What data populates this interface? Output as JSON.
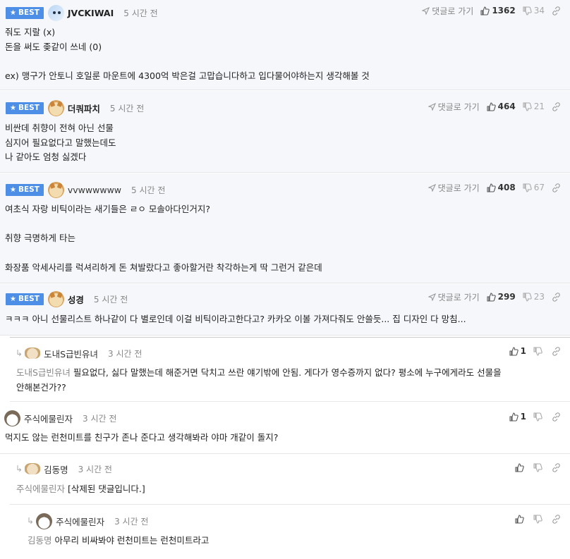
{
  "common": {
    "best_label": "BEST",
    "reply_link": "댓글로 가기"
  },
  "comments": [
    {
      "author": "JVCKIWAI",
      "time": "5 시간 전",
      "likes": "1362",
      "dislikes": "34",
      "lines": [
        "줘도 지랄 (x)",
        "돈을 써도 좆같이 쓰네 (0)",
        "",
        "ex) 맹구가 안토니 호일룬 마운트에 4300억 박은걸 고맙습니다하고 입다물어야하는지 생각해볼 것"
      ]
    },
    {
      "author": "더쿼파치",
      "time": "5 시간 전",
      "likes": "464",
      "dislikes": "21",
      "lines": [
        "비싼데 취향이 전혀 아닌 선물",
        "심지어 필요없다고 말했는데도",
        "나 같아도 엄청 싫겠다"
      ]
    },
    {
      "author": "vvwwwwww",
      "time": "5 시간 전",
      "likes": "408",
      "dislikes": "67",
      "lines": [
        "여초식 자랑 비틱이라는 새기들은 ㄹㅇ 모솔아다인거지?",
        "",
        "취향 극명하게 타는",
        "",
        "화장품 악세사리를 럭셔리하게 돈 쳐발랐다고 좋아할거란 착각하는게 딱 그런거 같은데"
      ]
    },
    {
      "author": "성경",
      "time": "5 시간 전",
      "likes": "299",
      "dislikes": "23",
      "lines": [
        "ㅋㅋㅋ 아니 선물리스트 하나같이 다 별로인데 이걸 비틱이라고한다고? 카카오 이볼 가져다줘도 안쓸듯... 집 디자인 다 망침..."
      ]
    },
    {
      "author": "도내S급빈유녀",
      "time": "3 시간 전",
      "likes": "1",
      "mention": "도내S급빈유녀",
      "lines": [
        " 필요없다, 싫다 말했는데 해준거면 닥치고 쓰란 얘기밖에 안됨. 게다가 영수증까지 없다? 평소에 누구에게라도 선물을",
        "안해본건가??"
      ]
    },
    {
      "author": "주식에물린자",
      "time": "3 시간 전",
      "likes": "1",
      "lines": [
        "먹지도 않는 런천미트를 친구가 존나 준다고 생각해봐라 야마 개같이 돌지?"
      ]
    },
    {
      "author": "김동명",
      "time": "3 시간 전",
      "mention": "주식에물린자",
      "lines": [
        " [삭제된 댓글입니다.]"
      ]
    },
    {
      "author": "주식에물린자",
      "time": "3 시간 전",
      "mention": "김동명",
      "lines": [
        " 아무리 비싸봐야 런천미트는 런천미트라고"
      ]
    }
  ]
}
